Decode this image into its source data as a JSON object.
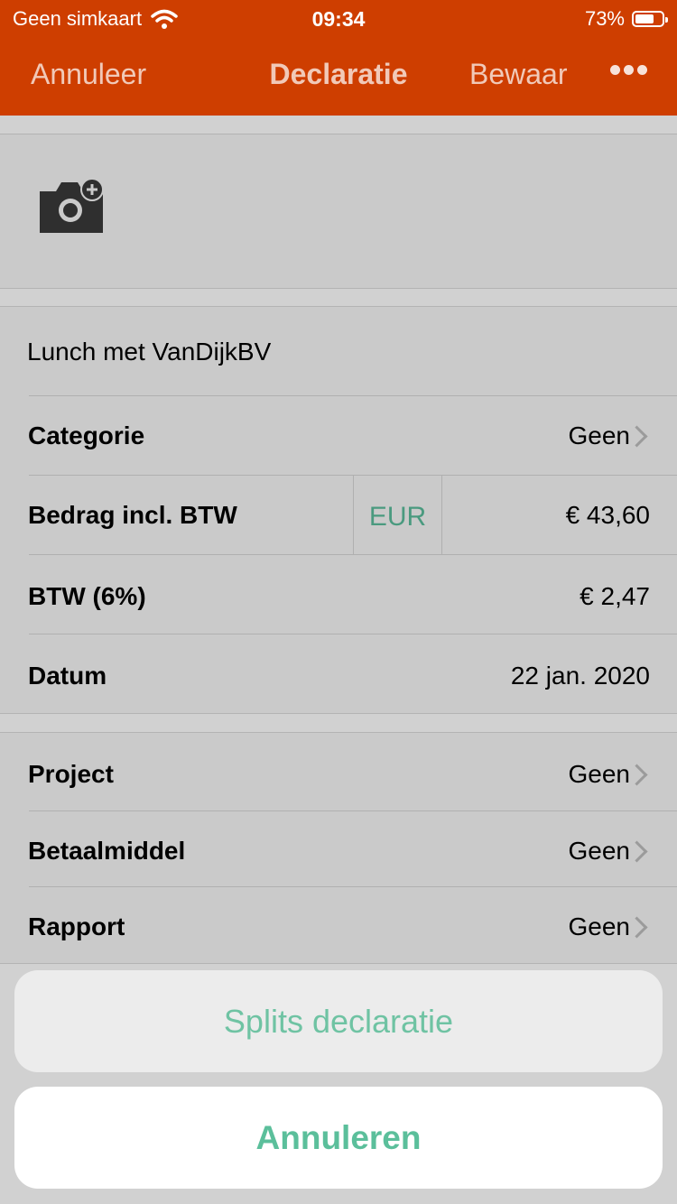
{
  "status": {
    "carrier": "Geen simkaart",
    "time": "09:34",
    "battery_percent_text": "73%",
    "battery_level": 0.73,
    "wifi_icon": "wifi-icon"
  },
  "nav": {
    "cancel_label": "Annuleer",
    "title": "Declaratie",
    "save_label": "Bewaar",
    "more_icon": "more-icon"
  },
  "photo": {
    "icon": "camera-add-icon"
  },
  "expense": {
    "title": "Lunch met VanDijkBV",
    "fields": {
      "category": {
        "label": "Categorie",
        "value": "Geen"
      },
      "amount": {
        "label": "Bedrag incl. BTW",
        "currency": "EUR",
        "value": "€ 43,60"
      },
      "vat": {
        "label": "BTW (6%)",
        "value": "€ 2,47"
      },
      "date": {
        "label": "Datum",
        "value": "22 jan. 2020"
      }
    },
    "extra": {
      "project": {
        "label": "Project",
        "value": "Geen"
      },
      "payment_method": {
        "label": "Betaalmiddel",
        "value": "Geen"
      },
      "report": {
        "label": "Rapport",
        "value": "Geen"
      }
    }
  },
  "action_sheet": {
    "split_label": "Splits declaratie",
    "cancel_label": "Annuleren"
  },
  "colors": {
    "header": "#ce3e00",
    "accent_green": "#5bbf9b",
    "overlay_background": "#d1d1d1"
  }
}
